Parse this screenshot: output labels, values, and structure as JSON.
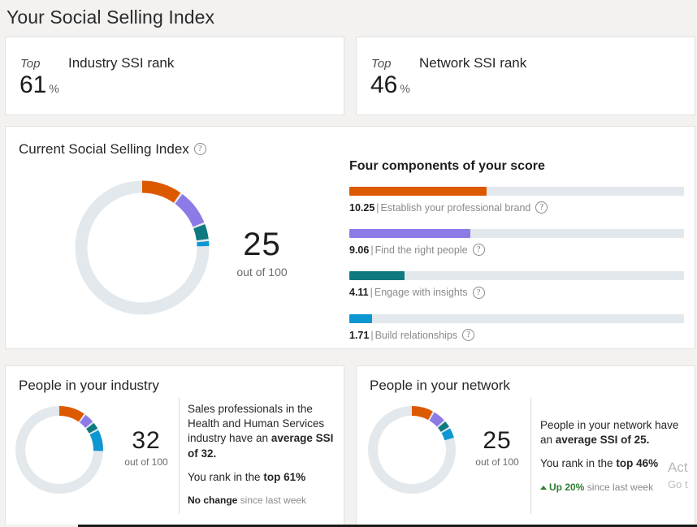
{
  "page": {
    "title": "Your Social Selling Index",
    "background": "#f3f2f1"
  },
  "rank_cards": [
    {
      "top_label": "Top",
      "heading": "Industry SSI rank",
      "value": "61",
      "unit": "%"
    },
    {
      "top_label": "Top",
      "heading": "Network SSI rank",
      "value": "46",
      "unit": "%"
    }
  ],
  "ssi_card": {
    "title": "Current Social Selling Index",
    "help_icon": "question-mark-circle-icon",
    "score": "25",
    "out_of": "out of 100",
    "components_title": "Four components of your score"
  },
  "chart_data": {
    "type": "pie",
    "title": "Current Social Selling Index",
    "total": 100,
    "score": 25.13,
    "labels": [
      "Establish your professional brand",
      "Find the right people",
      "Engage with insights",
      "Build relationships"
    ],
    "values": [
      10.25,
      9.06,
      4.11,
      1.71
    ],
    "colors": [
      "#dd5900",
      "#8c7ae6",
      "#0e7a7f",
      "#0c96d2"
    ],
    "track_color": "#e2e8ec",
    "bar_max": 25,
    "legend": "below-bar",
    "grid": false
  },
  "components": [
    {
      "value": "10.25",
      "separator": "|",
      "label": "Establish your professional brand",
      "color": "#dd5900",
      "fill_pct": 41,
      "help_icon": "question-mark-circle-icon"
    },
    {
      "value": "9.06",
      "separator": "|",
      "label": "Find the right people",
      "color": "#8c7ae6",
      "fill_pct": 36.2,
      "help_icon": "question-mark-circle-icon"
    },
    {
      "value": "4.11",
      "separator": "|",
      "label": "Engage with insights",
      "color": "#0e7a7f",
      "fill_pct": 16.4,
      "help_icon": "question-mark-circle-icon"
    },
    {
      "value": "1.71",
      "separator": "|",
      "label": "Build relationships",
      "color": "#0c96d2",
      "fill_pct": 6.9,
      "help_icon": "question-mark-circle-icon"
    }
  ],
  "people_cards": {
    "industry": {
      "title": "People in your industry",
      "score": "32",
      "out_of": "out of 100",
      "body_line1_pre": "Sales professionals in the Health and Human Services industry have an ",
      "body_line1_bold": "average SSI of 32.",
      "body_line2_pre": "You rank in the ",
      "body_line2_bold": "top 61%",
      "change_strong": "No change",
      "change_rest": " since last week",
      "trend": "none",
      "segments": [
        {
          "value": 10.25,
          "color": "#dd5900"
        },
        {
          "value": 4.2,
          "color": "#8c7ae6"
        },
        {
          "value": 3.1,
          "color": "#0e7a7f"
        },
        {
          "value": 8.5,
          "color": "#0c96d2"
        }
      ]
    },
    "network": {
      "title": "People in your network",
      "score": "25",
      "out_of": "out of 100",
      "body_line1_pre": "People in your network have an ",
      "body_line1_bold": "average SSI of 25.",
      "body_line2_pre": "You rank in the ",
      "body_line2_bold": "top 46%",
      "change_up": "Up 20%",
      "change_rest": " since last week",
      "trend": "up",
      "segments": [
        {
          "value": 8.6,
          "color": "#dd5900"
        },
        {
          "value": 5.2,
          "color": "#8c7ae6"
        },
        {
          "value": 3.0,
          "color": "#0e7a7f"
        },
        {
          "value": 4.3,
          "color": "#0c96d2"
        }
      ]
    }
  },
  "watermark": {
    "line1": "Act",
    "line2": "Go t"
  }
}
